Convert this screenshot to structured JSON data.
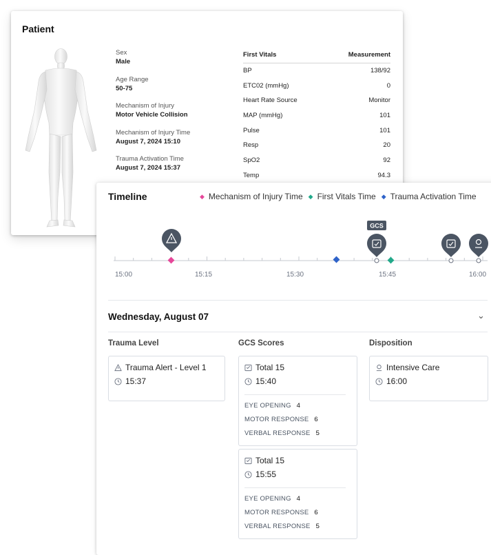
{
  "patient": {
    "title": "Patient",
    "fields": [
      {
        "label": "Sex",
        "value": "Male"
      },
      {
        "label": "Age Range",
        "value": "50-75"
      },
      {
        "label": "Mechanism of Injury",
        "value": "Motor Vehicle Collision"
      },
      {
        "label": "Mechanism of Injury Time",
        "value": "August 7, 2024 15:10"
      },
      {
        "label": "Trauma Activation Time",
        "value": "August 7, 2024 15:37"
      }
    ],
    "vitals": {
      "header_name": "First Vitals",
      "header_value": "Measurement",
      "rows": [
        {
          "name": "BP",
          "value": "138/92"
        },
        {
          "name": "ETC02 (mmHg)",
          "value": "0"
        },
        {
          "name": "Heart Rate Source",
          "value": "Monitor"
        },
        {
          "name": "MAP (mmHg)",
          "value": "101"
        },
        {
          "name": "Pulse",
          "value": "101"
        },
        {
          "name": "Resp",
          "value": "20"
        },
        {
          "name": "SpO2",
          "value": "92"
        },
        {
          "name": "Temp",
          "value": "94.3"
        }
      ]
    }
  },
  "timeline": {
    "title": "Timeline",
    "legend": [
      {
        "label": "Mechanism of Injury Time",
        "color": "#e6479a"
      },
      {
        "label": "First Vitals Time",
        "color": "#22a98a"
      },
      {
        "label": "Trauma Activation Time",
        "color": "#2f63c9"
      }
    ],
    "axis_ticks": [
      "15:00",
      "15:15",
      "15:30",
      "15:45",
      "16:00"
    ],
    "markers": {
      "mechanism_time": "15:10",
      "trauma_activation_time": "15:37",
      "first_vitals_time": "15:45"
    },
    "pins": [
      {
        "time": "15:10",
        "icon": "warning-icon"
      },
      {
        "time": "15:40",
        "icon": "clipboard-icon",
        "tag": "GCS"
      },
      {
        "time": "15:55",
        "icon": "clipboard-icon"
      },
      {
        "time": "16:00",
        "icon": "location-pin-icon"
      }
    ],
    "date_heading": "Wednesday, August 07",
    "columns": {
      "trauma": {
        "title": "Trauma Level",
        "cards": [
          {
            "label": "Trauma Alert - Level 1",
            "time": "15:37"
          }
        ]
      },
      "gcs": {
        "title": "GCS Scores",
        "cards": [
          {
            "label": "Total 15",
            "time": "15:40",
            "eye_label": "EYE OPENING",
            "eye": "4",
            "motor_label": "MOTOR RESPONSE",
            "motor": "6",
            "verbal_label": "VERBAL RESPONSE",
            "verbal": "5"
          },
          {
            "label": "Total 15",
            "time": "15:55",
            "eye_label": "EYE OPENING",
            "eye": "4",
            "motor_label": "MOTOR RESPONSE",
            "motor": "6",
            "verbal_label": "VERBAL RESPONSE",
            "verbal": "5"
          }
        ]
      },
      "disposition": {
        "title": "Disposition",
        "cards": [
          {
            "label": "Intensive Care",
            "time": "16:00"
          }
        ]
      }
    }
  },
  "colors": {
    "pin": "#4b5563",
    "axis": "#9ca3af",
    "mechanism": "#e6479a",
    "vitals": "#22a98a",
    "activation": "#2f63c9"
  }
}
